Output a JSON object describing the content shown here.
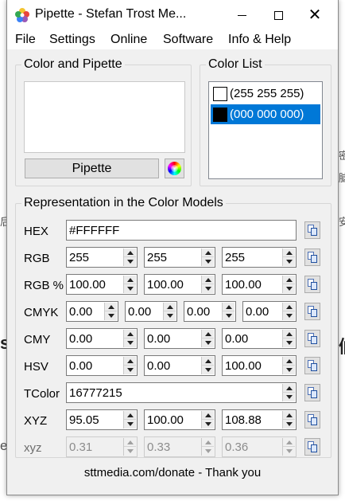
{
  "background": {
    "left_fragment": "后",
    "right_fragment_1": "密",
    "right_fragment_2": "脑",
    "right_fragment_3": "安",
    "left_big": "s",
    "right_big": "们",
    "left_e": "e"
  },
  "window": {
    "title": "Pipette - Stefan Trost Me...",
    "controls": {
      "minimize": "–",
      "maximize": "□",
      "close": "✕"
    }
  },
  "menu": {
    "items": [
      "File",
      "Settings",
      "Online",
      "Software",
      "Info & Help"
    ]
  },
  "color_pipette": {
    "title": "Color and Pipette",
    "pipette_button": "Pipette",
    "preview_color": "#FFFFFF"
  },
  "color_list": {
    "title": "Color List",
    "items": [
      {
        "label": "(255 255 255)",
        "color": "#FFFFFF",
        "selected": false
      },
      {
        "label": "(000 000 000)",
        "color": "#000000",
        "selected": true
      }
    ]
  },
  "models": {
    "title": "Representation in the Color Models",
    "rows": [
      {
        "label": "HEX",
        "values": [
          "#FFFFFF"
        ],
        "disabled": false
      },
      {
        "label": "RGB",
        "values": [
          "255",
          "255",
          "255"
        ],
        "disabled": false
      },
      {
        "label": "RGB %",
        "values": [
          "100.00",
          "100.00",
          "100.00"
        ],
        "disabled": false
      },
      {
        "label": "CMYK",
        "values": [
          "0.00",
          "0.00",
          "0.00",
          "0.00"
        ],
        "disabled": false
      },
      {
        "label": "CMY",
        "values": [
          "0.00",
          "0.00",
          "0.00"
        ],
        "disabled": false
      },
      {
        "label": "HSV",
        "values": [
          "0.00",
          "0.00",
          "100.00"
        ],
        "disabled": false
      },
      {
        "label": "TColor",
        "values": [
          "16777215"
        ],
        "disabled": false
      },
      {
        "label": "XYZ",
        "values": [
          "95.05",
          "100.00",
          "108.88"
        ],
        "disabled": false
      },
      {
        "label": "xyz",
        "values": [
          "0.31",
          "0.33",
          "0.36"
        ],
        "disabled": true
      }
    ]
  },
  "footer": {
    "text": "sttmedia.com/donate - Thank you"
  },
  "colors": {
    "selection": "#0078d7",
    "window_bg": "#f0f0f0"
  }
}
